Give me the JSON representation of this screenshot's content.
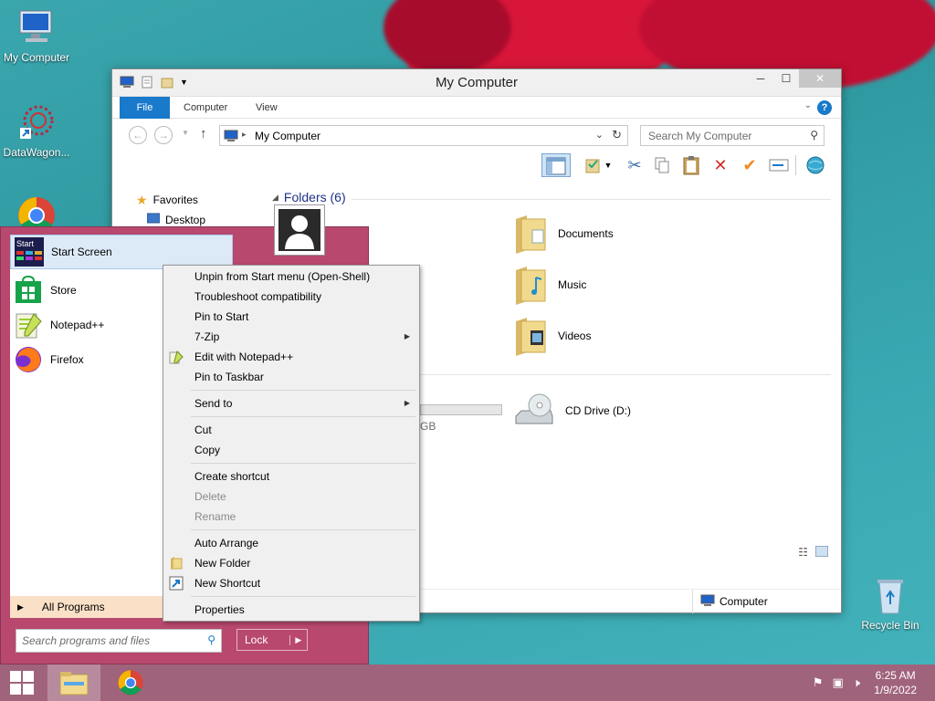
{
  "desktop": {
    "icons": [
      {
        "label": "My Computer"
      },
      {
        "label": "DataWagon..."
      },
      {
        "label": "Recycle Bin"
      }
    ]
  },
  "explorer": {
    "title": "My Computer",
    "tabs": [
      "File",
      "Computer",
      "View"
    ],
    "help_label": "?",
    "address": "My Computer",
    "search_placeholder": "Search My Computer",
    "nav": {
      "favorites": "Favorites",
      "desktop": "Desktop"
    },
    "section_folders": "Folders (6)",
    "folders": [
      {
        "label": "Documents"
      },
      {
        "label": "Music"
      },
      {
        "label": "Videos"
      }
    ],
    "drive_partial": "GB",
    "cd_drive": "CD Drive (D:)",
    "status_location": "Computer"
  },
  "start_menu": {
    "items": [
      {
        "label": "Start Screen",
        "icon_text": "Start"
      },
      {
        "label": "Store"
      },
      {
        "label": "Notepad++"
      },
      {
        "label": "Firefox"
      }
    ],
    "all_programs": "All Programs",
    "search_placeholder": "Search programs and files",
    "lock": "Lock"
  },
  "context_menu": {
    "items": [
      {
        "label": "Unpin from Start menu (Open-Shell)"
      },
      {
        "label": "Troubleshoot compatibility"
      },
      {
        "label": "Pin to Start"
      },
      {
        "label": "7-Zip"
      },
      {
        "label": "Edit with Notepad++"
      },
      {
        "label": "Pin to Taskbar"
      },
      {
        "label": "Send to"
      },
      {
        "label": "Cut"
      },
      {
        "label": "Copy"
      },
      {
        "label": "Create shortcut"
      },
      {
        "label": "Delete"
      },
      {
        "label": "Rename"
      },
      {
        "label": "Auto Arrange"
      },
      {
        "label": "New Folder"
      },
      {
        "label": "New Shortcut"
      },
      {
        "label": "Properties"
      }
    ]
  },
  "taskbar": {
    "time": "6:25 AM",
    "date": "1/9/2022"
  },
  "colors": {
    "accent": "#1979ca",
    "startmenu": "#b8486e",
    "taskbar": "#a0637c"
  }
}
